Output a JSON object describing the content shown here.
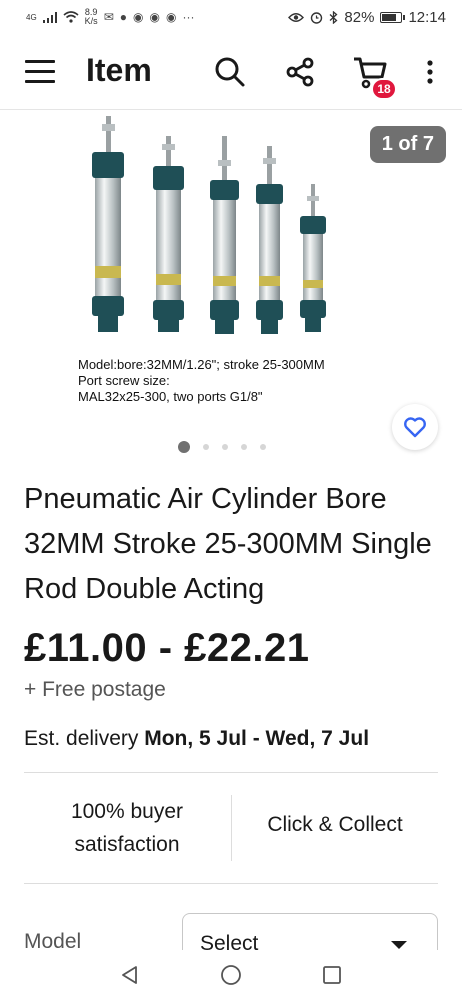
{
  "status_bar": {
    "network": "4G",
    "speed_value": "8.9",
    "speed_unit": "K/s",
    "battery": "82%",
    "battery_level": 0.82,
    "time": "12:14"
  },
  "header": {
    "title": "Item",
    "cart_count": "18"
  },
  "gallery": {
    "counter": "1 of 7",
    "caption_lines": [
      "Model:bore:32MM/1.26\"; stroke 25-300MM",
      "Port screw size:",
      "MAL32x25-300, two ports G1/8\""
    ],
    "dots_total": 5,
    "dot_active": 1
  },
  "product": {
    "title": "Pneumatic Air Cylinder Bore 32MM Stroke 25-300MM Single Rod Double Acting",
    "price": "£11.00 - £22.21",
    "postage": "+ Free postage",
    "delivery_label": "Est. delivery ",
    "delivery_dates": "Mon, 5 Jul - Wed, 7 Jul"
  },
  "features": {
    "satisfaction_line1": "100% buyer",
    "satisfaction_line2": "satisfaction",
    "click_collect": "Click & Collect"
  },
  "variation": {
    "label": "Model",
    "value": "Select"
  },
  "colors": {
    "badge": "#e0173d",
    "heart": "#3665f3",
    "pill": "#707070",
    "cylinder_body": "#1f4f56"
  }
}
